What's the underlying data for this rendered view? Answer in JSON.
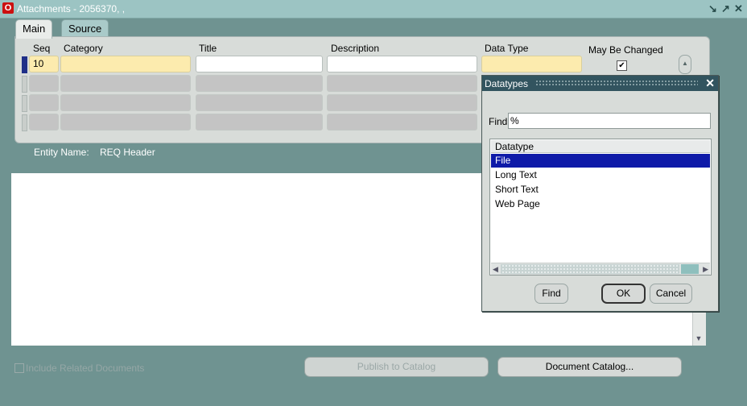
{
  "window": {
    "title": "Attachments - 2056370, ,",
    "app_icon": "oracle-o-icon",
    "controls": [
      "minimize-icon",
      "maximize-icon",
      "close-icon"
    ]
  },
  "tabs": [
    {
      "label": "Main",
      "active": true
    },
    {
      "label": "Source",
      "active": false
    }
  ],
  "grid": {
    "columns": [
      "Seq",
      "Category",
      "Title",
      "Description",
      "Data Type",
      "May Be Changed"
    ],
    "rows": [
      {
        "seq": "10",
        "category": "",
        "title": "",
        "description": "",
        "data_type": "",
        "may_be_changed": true
      },
      {
        "seq": "",
        "category": "",
        "title": "",
        "description": "",
        "data_type": "",
        "may_be_changed": false
      },
      {
        "seq": "",
        "category": "",
        "title": "",
        "description": "",
        "data_type": "",
        "may_be_changed": false
      },
      {
        "seq": "",
        "category": "",
        "title": "",
        "description": "",
        "data_type": "",
        "may_be_changed": false
      }
    ]
  },
  "entity": {
    "label": "Entity Name:",
    "value": "REQ Header"
  },
  "footer": {
    "include_related_label": "Include Related Documents",
    "publish_label": "Publish to Catalog",
    "document_catalog_label": "Document Catalog..."
  },
  "dialog": {
    "title": "Datatypes",
    "find_label": "Find",
    "find_value": "%",
    "list_header": "Datatype",
    "items": [
      "File",
      "Long Text",
      "Short Text",
      "Web Page"
    ],
    "selected_index": 0,
    "find_button": "Find",
    "ok_button": "OK",
    "cancel_button": "Cancel"
  },
  "colors": {
    "window_bg": "#6f9391",
    "titlebar": "#9cc4c3",
    "required_field": "#fcebae",
    "selection": "#0e1aa8",
    "dialog_title": "#32545f"
  }
}
